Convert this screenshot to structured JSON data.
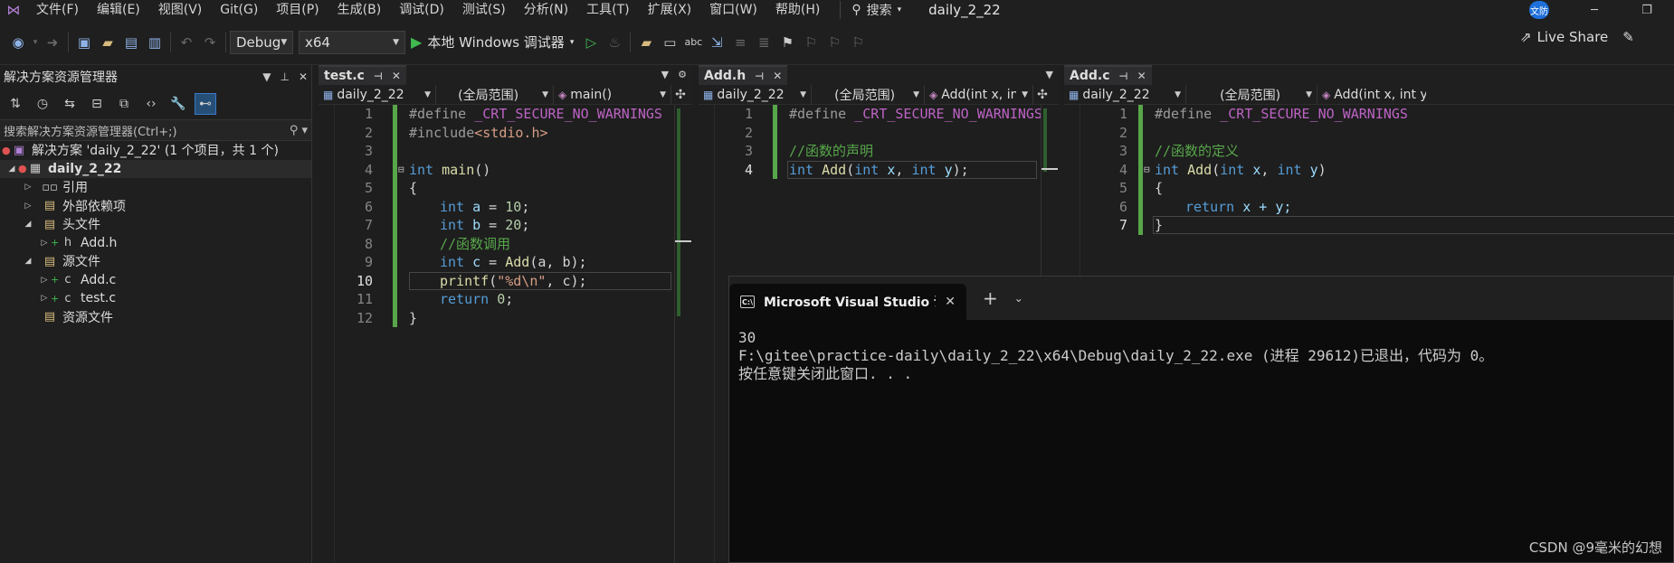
{
  "menubar": {
    "items": [
      "文件(F)",
      "编辑(E)",
      "视图(V)",
      "Git(G)",
      "项目(P)",
      "生成(B)",
      "调试(D)",
      "测试(S)",
      "分析(N)",
      "工具(T)",
      "扩展(X)",
      "窗口(W)",
      "帮助(H)"
    ],
    "search_label": "搜索",
    "project_title": "daily_2_22",
    "avatar_text": "文防"
  },
  "toolbar": {
    "config": "Debug",
    "platform": "x64",
    "run_label": "本地 Windows 调试器",
    "liveshare": "Live Share"
  },
  "solution_explorer": {
    "title": "解决方案资源管理器",
    "search_placeholder": "搜索解决方案资源管理器(Ctrl+;)",
    "nodes": {
      "solution": "解决方案 'daily_2_22' (1 个项目，共 1 个)",
      "project": "daily_2_22",
      "references": "引用",
      "external_deps": "外部依赖项",
      "header_files": "头文件",
      "add_h": "Add.h",
      "source_files": "源文件",
      "add_c": "Add.c",
      "test_c": "test.c",
      "resource_files": "资源文件"
    }
  },
  "editors": {
    "test_c": {
      "tab": "test.c",
      "nav": [
        "daily_2_22",
        "(全局范围)",
        "main()"
      ],
      "lines": [
        "1",
        "2",
        "3",
        "4",
        "5",
        "6",
        "7",
        "8",
        "9",
        "10",
        "11",
        "12"
      ],
      "current_line": "10"
    },
    "add_h": {
      "tab": "Add.h",
      "nav": [
        "daily_2_22",
        "(全局范围)",
        "Add(int x, int y)"
      ],
      "lines": [
        "1",
        "2",
        "3",
        "4"
      ],
      "current_line": "4"
    },
    "add_c": {
      "tab": "Add.c",
      "nav": [
        "daily_2_22",
        "(全局范围)",
        "Add(int x, int y)"
      ],
      "lines": [
        "1",
        "2",
        "3",
        "4",
        "5",
        "6",
        "7"
      ],
      "current_line": "7"
    }
  },
  "code": {
    "define_kw": "#define",
    "define_macro": " _CRT_SECURE_NO_WARNINGS",
    "include_kw": "#include",
    "include_file": "<stdio.h>",
    "int": "int",
    "main": " main",
    "main_paren": "()",
    "brace_open": "{",
    "brace_close": "}",
    "a": " a",
    "b": " b",
    "c": " c",
    "eq": " = ",
    "ten": "10",
    "twenty": "20",
    "semi": ";",
    "cmt_call": "//函数调用",
    "add_call": "Add",
    "add_args": "(a, b);",
    "printf": "printf",
    "printf_open": "(",
    "printf_fmt": "\"%d\\n\"",
    "printf_rest": ", c);",
    "return": "return",
    "zero": " 0",
    "cmt_decl": "//函数的声明",
    "add_fn": " Add",
    "params_open": "(",
    "x": " x",
    "comma": ", ",
    "y": " y",
    "params_close": ");",
    "params_close_def": ")",
    "cmt_def": "//函数的定义",
    "ret_expr": " x + y;"
  },
  "console": {
    "tab_label": "Microsoft Visual Studio 调试控制台",
    "output": [
      "30",
      "",
      "F:\\gitee\\practice-daily\\daily_2_22\\x64\\Debug\\daily_2_22.exe (进程 29612)已退出，代码为 0。",
      "按任意键关闭此窗口. . ."
    ]
  },
  "watermark": "CSDN @9毫米的幻想"
}
